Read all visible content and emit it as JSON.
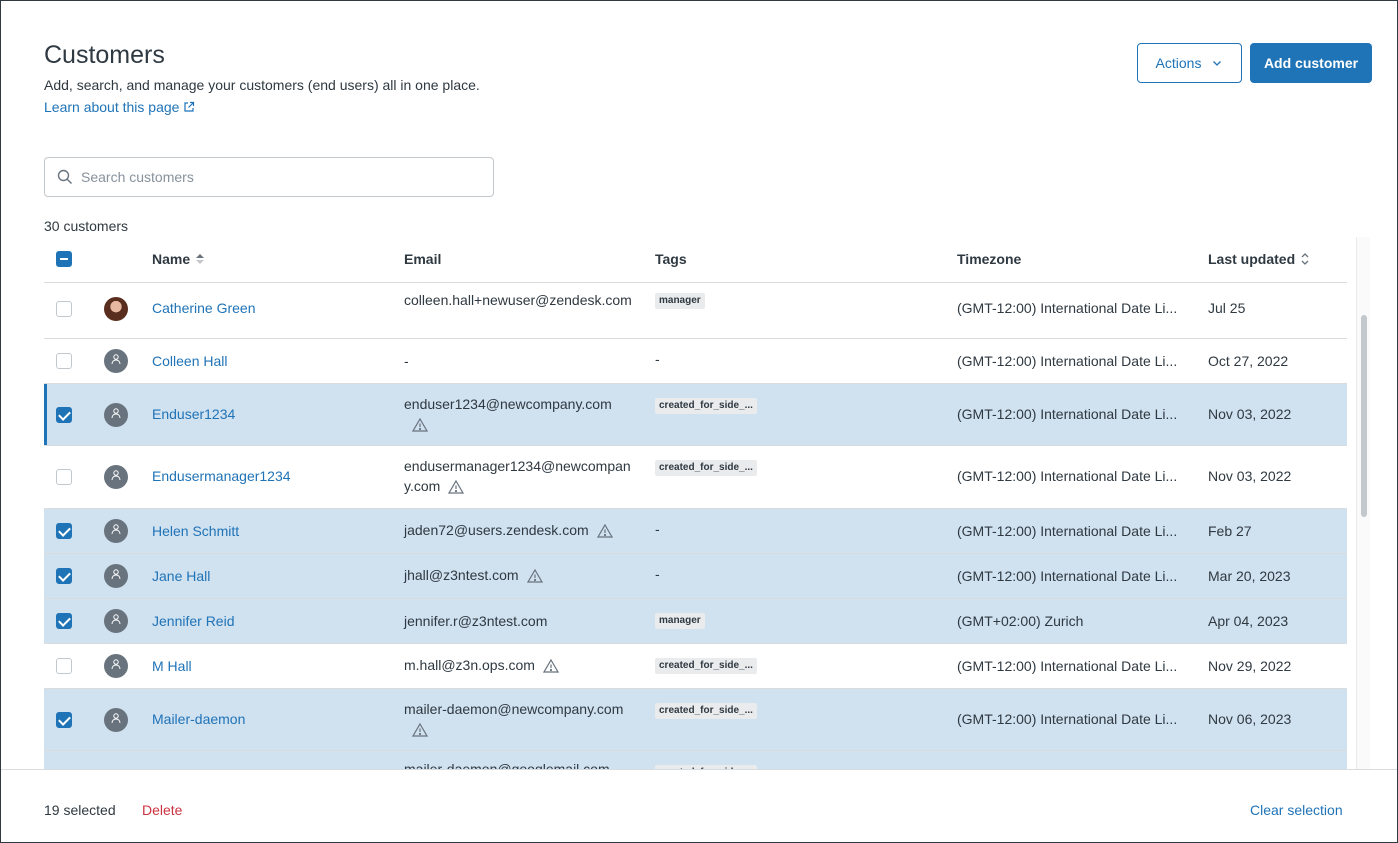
{
  "header": {
    "title": "Customers",
    "subtitle": "Add, search, and manage your customers (end users) all in one place.",
    "learn_link": "Learn about this page",
    "actions_label": "Actions",
    "add_label": "Add customer"
  },
  "search": {
    "placeholder": "Search customers"
  },
  "count_label": "30 customers",
  "columns": {
    "name": "Name",
    "email": "Email",
    "tags": "Tags",
    "timezone": "Timezone",
    "last_updated": "Last updated"
  },
  "rows": [
    {
      "name": "Catherine Green",
      "email": "colleen.hall+newuser@zendesk.com",
      "tag": "manager",
      "timezone": "(GMT-12:00) International Date Li...",
      "updated": "Jul 25",
      "selected": false,
      "warn": false,
      "avatar": "photo"
    },
    {
      "name": "Colleen Hall",
      "email": "-",
      "tag": "-",
      "timezone": "(GMT-12:00) International Date Li...",
      "updated": "Oct 27, 2022",
      "selected": false,
      "warn": false,
      "avatar": "default"
    },
    {
      "name": "Enduser1234",
      "email": "enduser1234@newcompany.com",
      "tag": "created_for_side_...",
      "timezone": "(GMT-12:00) International Date Li...",
      "updated": "Nov 03, 2022",
      "selected": true,
      "warn": true,
      "avatar": "default"
    },
    {
      "name": "Endusermanager1234",
      "email": "endusermanager1234@newcompany.com",
      "tag": "created_for_side_...",
      "timezone": "(GMT-12:00) International Date Li...",
      "updated": "Nov 03, 2022",
      "selected": false,
      "warn": true,
      "avatar": "default"
    },
    {
      "name": "Helen Schmitt",
      "email": "jaden72@users.zendesk.com",
      "tag": "-",
      "timezone": "(GMT-12:00) International Date Li...",
      "updated": "Feb 27",
      "selected": true,
      "warn": true,
      "avatar": "default"
    },
    {
      "name": "Jane Hall",
      "email": "jhall@z3ntest.com",
      "tag": "-",
      "timezone": "(GMT-12:00) International Date Li...",
      "updated": "Mar 20, 2023",
      "selected": true,
      "warn": true,
      "avatar": "default"
    },
    {
      "name": "Jennifer Reid",
      "email": "jennifer.r@z3ntest.com",
      "tag": "manager",
      "timezone": "(GMT+02:00) Zurich",
      "updated": "Apr 04, 2023",
      "selected": true,
      "warn": false,
      "avatar": "default"
    },
    {
      "name": "M Hall",
      "email": "m.hall@z3n.ops.com",
      "tag": "created_for_side_...",
      "timezone": "(GMT-12:00) International Date Li...",
      "updated": "Nov 29, 2022",
      "selected": false,
      "warn": true,
      "avatar": "default"
    },
    {
      "name": "Mailer-daemon",
      "email": "mailer-daemon@newcompany.com",
      "tag": "created_for_side_...",
      "timezone": "(GMT-12:00) International Date Li...",
      "updated": "Nov 06, 2023",
      "selected": true,
      "warn": true,
      "avatar": "default"
    },
    {
      "name": "",
      "email": "mailer-daemon@googlemail.com",
      "tag": "created_for_side_...",
      "timezone": "",
      "updated": "",
      "selected": true,
      "warn": false,
      "avatar": "none"
    }
  ],
  "footer": {
    "selected_label": "19 selected",
    "delete_label": "Delete",
    "clear_label": "Clear selection"
  }
}
